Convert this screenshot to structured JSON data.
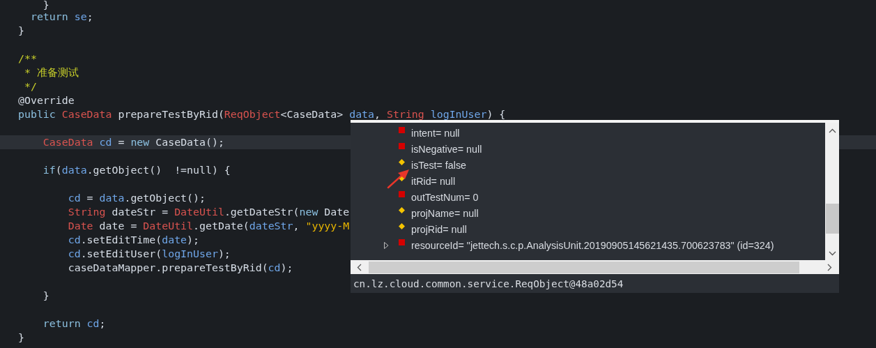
{
  "editor": {
    "lines": [
      {
        "kind": "code",
        "current": false,
        "tokens": [
          {
            "kind": "plain",
            "text": "    }"
          }
        ]
      },
      {
        "kind": "code",
        "current": false,
        "tokens": [
          {
            "kind": "keyword",
            "text": "  return"
          },
          {
            "kind": "variable",
            "text": " se"
          },
          {
            "kind": "plain",
            "text": ";"
          }
        ]
      },
      {
        "kind": "code",
        "current": false,
        "tokens": [
          {
            "kind": "plain",
            "text": "}"
          }
        ]
      },
      {
        "kind": "blank",
        "current": false
      },
      {
        "kind": "code",
        "current": false,
        "tokens": [
          {
            "kind": "comment",
            "text": "/**"
          }
        ]
      },
      {
        "kind": "code",
        "current": false,
        "tokens": [
          {
            "kind": "comment",
            "text": " * 准备测试"
          }
        ]
      },
      {
        "kind": "code",
        "current": false,
        "tokens": [
          {
            "kind": "comment",
            "text": " */"
          }
        ]
      },
      {
        "kind": "code",
        "current": false,
        "tokens": [
          {
            "kind": "plain",
            "text": "@Override"
          }
        ]
      },
      {
        "kind": "code",
        "current": false,
        "tokens": [
          {
            "kind": "keyword",
            "text": "public"
          },
          {
            "kind": "type",
            "text": " CaseData"
          },
          {
            "kind": "plain",
            "text": " prepareTestByRid("
          },
          {
            "kind": "type",
            "text": "ReqObject"
          },
          {
            "kind": "plain",
            "text": "<CaseData> "
          },
          {
            "kind": "variable",
            "text": "data"
          },
          {
            "kind": "plain",
            "text": ", "
          },
          {
            "kind": "type",
            "text": "String"
          },
          {
            "kind": "variable",
            "text": " logInUser"
          },
          {
            "kind": "plain",
            "text": ") {"
          }
        ]
      },
      {
        "kind": "blank",
        "current": false
      },
      {
        "kind": "code",
        "current": true,
        "tokens": [
          {
            "kind": "type",
            "text": "    CaseData"
          },
          {
            "kind": "variable",
            "text": " cd"
          },
          {
            "kind": "plain",
            "text": " = "
          },
          {
            "kind": "keyword",
            "text": "new"
          },
          {
            "kind": "plain",
            "text": " CaseData();"
          }
        ]
      },
      {
        "kind": "blank",
        "current": false
      },
      {
        "kind": "code",
        "current": false,
        "tokens": [
          {
            "kind": "keyword",
            "text": "    if"
          },
          {
            "kind": "plain",
            "text": "("
          },
          {
            "kind": "variable",
            "text": "data"
          },
          {
            "kind": "plain",
            "text": ".getObject()  !=null) {"
          }
        ]
      },
      {
        "kind": "blank",
        "current": false
      },
      {
        "kind": "code",
        "current": false,
        "tokens": [
          {
            "kind": "variable",
            "text": "        cd"
          },
          {
            "kind": "plain",
            "text": " = "
          },
          {
            "kind": "variable",
            "text": "data"
          },
          {
            "kind": "plain",
            "text": ".getObject();"
          }
        ]
      },
      {
        "kind": "code",
        "current": false,
        "tokens": [
          {
            "kind": "type",
            "text": "        String"
          },
          {
            "kind": "plain",
            "text": " dateStr = "
          },
          {
            "kind": "type",
            "text": "DateUtil"
          },
          {
            "kind": "plain",
            "text": ".getDateStr("
          },
          {
            "kind": "keyword",
            "text": "new"
          },
          {
            "kind": "plain",
            "text": " Date"
          }
        ]
      },
      {
        "kind": "code",
        "current": false,
        "tokens": [
          {
            "kind": "type",
            "text": "        Date"
          },
          {
            "kind": "plain",
            "text": " date = "
          },
          {
            "kind": "type",
            "text": "DateUtil"
          },
          {
            "kind": "plain",
            "text": ".getDate("
          },
          {
            "kind": "variable",
            "text": "dateStr"
          },
          {
            "kind": "plain",
            "text": ", "
          },
          {
            "kind": "string",
            "text": "\"yyyy-M"
          }
        ]
      },
      {
        "kind": "code",
        "current": false,
        "tokens": [
          {
            "kind": "variable",
            "text": "        cd"
          },
          {
            "kind": "plain",
            "text": ".setEditTime("
          },
          {
            "kind": "variable",
            "text": "date"
          },
          {
            "kind": "plain",
            "text": ");"
          }
        ]
      },
      {
        "kind": "code",
        "current": false,
        "tokens": [
          {
            "kind": "variable",
            "text": "        cd"
          },
          {
            "kind": "plain",
            "text": ".setEditUser("
          },
          {
            "kind": "variable",
            "text": "logInUser"
          },
          {
            "kind": "plain",
            "text": ");"
          }
        ]
      },
      {
        "kind": "code",
        "current": false,
        "tokens": [
          {
            "kind": "plain",
            "text": "        caseDataMapper.prepareTestByRid("
          },
          {
            "kind": "variable",
            "text": "cd"
          },
          {
            "kind": "plain",
            "text": ");"
          }
        ]
      },
      {
        "kind": "blank",
        "current": false
      },
      {
        "kind": "code",
        "current": false,
        "tokens": [
          {
            "kind": "plain",
            "text": "    }"
          }
        ]
      },
      {
        "kind": "blank",
        "current": false
      },
      {
        "kind": "code",
        "current": false,
        "tokens": [
          {
            "kind": "keyword",
            "text": "    return"
          },
          {
            "kind": "variable",
            "text": " cd"
          },
          {
            "kind": "plain",
            "text": ";"
          }
        ]
      },
      {
        "kind": "code",
        "current": false,
        "tokens": [
          {
            "kind": "plain",
            "text": "}"
          }
        ]
      }
    ]
  },
  "inspect_popup": {
    "fields": [
      {
        "kind": "private",
        "expandable": false,
        "label": "intent= null"
      },
      {
        "kind": "private",
        "expandable": false,
        "label": "isNegative= null"
      },
      {
        "kind": "package",
        "expandable": false,
        "label": "isTest= false"
      },
      {
        "kind": "package",
        "expandable": false,
        "label": "itRid= null"
      },
      {
        "kind": "private",
        "expandable": false,
        "label": "outTestNum= 0"
      },
      {
        "kind": "package",
        "expandable": false,
        "label": "projName= null"
      },
      {
        "kind": "package",
        "expandable": false,
        "label": "projRid= null"
      },
      {
        "kind": "private",
        "expandable": true,
        "label": "resourceId= \"jettech.s.c.p.AnalysisUnit.20190905145621435.700623783\" (id=324)"
      }
    ],
    "detail": "cn.lz.cloud.common.service.ReqObject@48a02d54"
  }
}
